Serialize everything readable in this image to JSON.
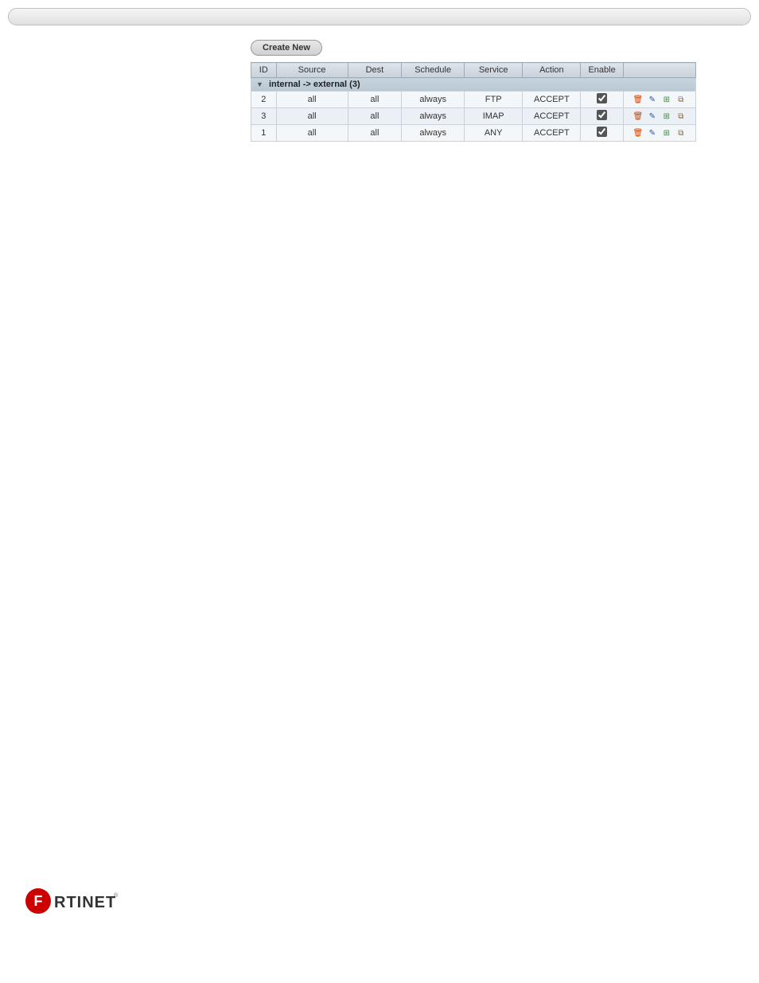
{
  "topbar": {
    "visible": true
  },
  "toolbar": {
    "create_new_label": "Create New"
  },
  "table": {
    "columns": [
      "ID",
      "Source",
      "Dest",
      "Schedule",
      "Service",
      "Action",
      "Enable",
      ""
    ],
    "group_header": "internal -> external (3)",
    "rows": [
      {
        "id": "2",
        "source": "all",
        "dest": "all",
        "schedule": "always",
        "service": "FTP",
        "action": "ACCEPT",
        "enabled": true
      },
      {
        "id": "3",
        "source": "all",
        "dest": "all",
        "schedule": "always",
        "service": "IMAP",
        "action": "ACCEPT",
        "enabled": true
      },
      {
        "id": "1",
        "source": "all",
        "dest": "all",
        "schedule": "always",
        "service": "ANY",
        "action": "ACCEPT",
        "enabled": true
      }
    ]
  },
  "logo": {
    "brand": "FORTINET",
    "registered": "®"
  },
  "icons": {
    "delete": "🗑",
    "edit": "✎",
    "move": "⊞",
    "copy": "⧉",
    "arrow_down": "▼"
  }
}
